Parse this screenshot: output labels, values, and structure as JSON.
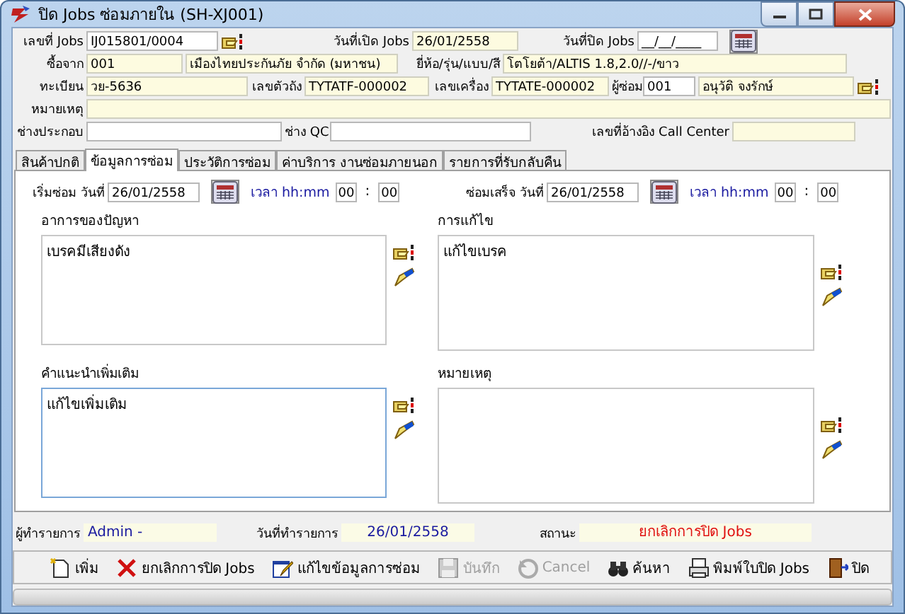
{
  "window": {
    "title": "ปิด Jobs ซ่อมภายใน (SH-XJ001)"
  },
  "header": {
    "job_no": {
      "label": "เลขที่ Jobs",
      "value": "IJ015801/0004",
      "readonly": false
    },
    "open_date": {
      "label": "วันที่เปิด Jobs",
      "value": "26/01/2558",
      "readonly": true
    },
    "close_date": {
      "label": "วันที่ปิด Jobs",
      "value": "__/__/____",
      "readonly": false
    },
    "bought_from": {
      "label": "ซื้อจาก",
      "code": "001",
      "name": "เมืองไทยประกันภัย จำกัด (มหาชน)",
      "readonly": true
    },
    "brand": {
      "label": "ยี่ห้อ/รุ่น/แบบ/สี",
      "value": "โตโยต้า/ALTIS 1.8,2.0//-/ขาว",
      "readonly": true
    },
    "plate": {
      "label": "ทะเบียน",
      "value": "วย-5636",
      "readonly": true
    },
    "chassis": {
      "label": "เลขตัวถัง",
      "value": "TYTATF-000002",
      "readonly": true
    },
    "engine": {
      "label": "เลขเครื่อง",
      "value": "TYTATE-000002",
      "readonly": true
    },
    "mechanic": {
      "label": "ผู้ซ่อม",
      "code": "001",
      "name": "อนุวัติ จงรักษ์",
      "readonly": false
    },
    "note": {
      "label": "หมายเหตุ",
      "readonly": true
    },
    "assembler": {
      "label": "ช่างประกอบ",
      "readonly": false
    },
    "qc": {
      "label": "ช่าง QC",
      "readonly": false
    },
    "call_center": {
      "label": "เลขที่อ้างอิง Call Center",
      "readonly": true
    }
  },
  "tabs": [
    {
      "label": "สินค้าปกติ",
      "selected": false
    },
    {
      "label": "ข้อมูลการซ่อม",
      "selected": true
    },
    {
      "label": "ประวัติการซ่อม",
      "selected": false
    },
    {
      "label": "ค่าบริการ งานซ่อมภายนอก",
      "selected": false
    },
    {
      "label": "รายการที่รับกลับคืน",
      "selected": false
    }
  ],
  "repair_times": [
    {
      "label": "เริ่มซ่อม วันที่",
      "date": "26/01/2558",
      "time_label": "เวลา hh:mm",
      "hour": "00",
      "separator": ":",
      "minute": "00"
    },
    {
      "label": "ซ่อมเสร็จ วันที่",
      "date": "26/01/2558",
      "time_label": "เวลา hh:mm",
      "hour": "00",
      "separator": ":",
      "minute": "00"
    }
  ],
  "notes": [
    {
      "label": "อาการของปัญหา",
      "value": "เบรคมีเสียงดัง",
      "focused": false
    },
    {
      "label": "การแก้ไข",
      "value": "แก้ไขเบรค",
      "focused": false
    },
    {
      "label": "คำแนะนำเพิ่มเติม",
      "value": "แก้ไขเพิ่มเติม",
      "focused": true
    },
    {
      "label": "หมายเหตุ",
      "focused": false
    }
  ],
  "footer": {
    "recorder": {
      "label": "ผู้ทำรายการ",
      "value": "Admin -"
    },
    "record_date": {
      "label": "วันที่ทำรายการ",
      "value": "26/01/2558"
    },
    "status": {
      "label": "สถานะ",
      "value": "ยกเลิกการปิด Jobs"
    }
  },
  "toolbar": [
    {
      "kind": "new",
      "label": "เพิ่ม",
      "disabled": false
    },
    {
      "kind": "cancel",
      "label": "ยกเลิกการปิด Jobs",
      "disabled": false
    },
    {
      "kind": "edit",
      "label": "แก้ไขข้อมูลการซ่อม",
      "disabled": false
    },
    {
      "kind": "save",
      "label": "บันทึก",
      "disabled": true
    },
    {
      "kind": "undo",
      "label": "Cancel",
      "disabled": true
    },
    {
      "kind": "find",
      "label": "ค้นหา",
      "disabled": false
    },
    {
      "kind": "print",
      "label": "พิมพ์ใบปิด Jobs",
      "disabled": false
    },
    {
      "kind": "exit",
      "label": "ปิด",
      "disabled": false
    }
  ]
}
